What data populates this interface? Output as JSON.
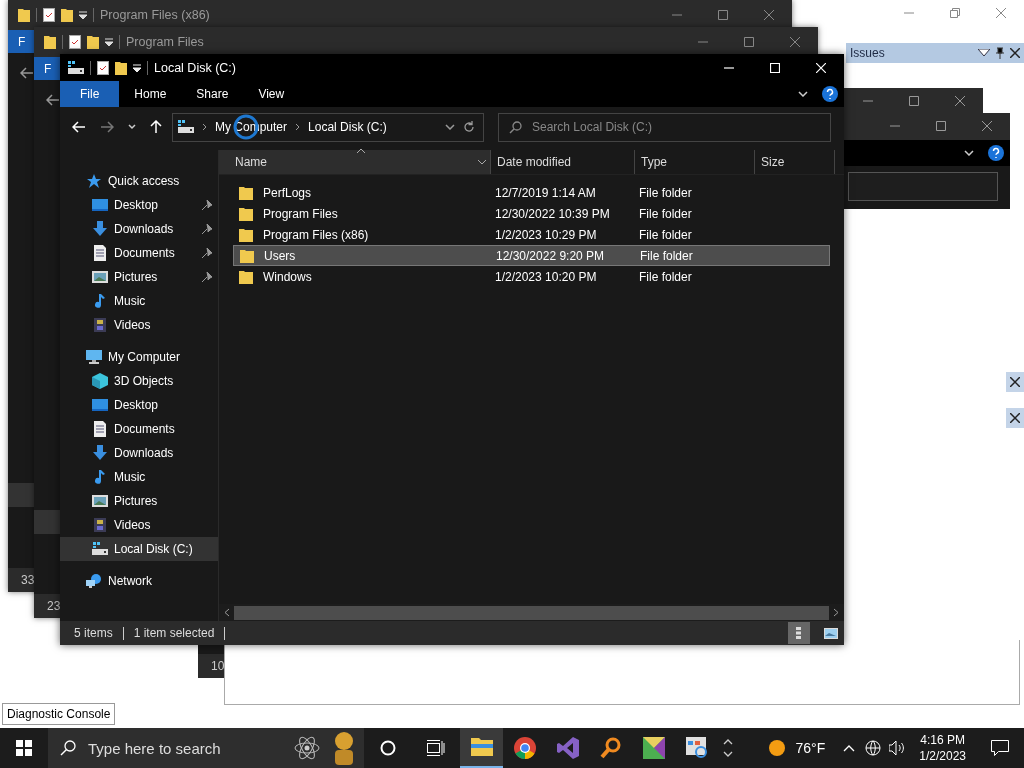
{
  "background_app": {
    "panel_title": "Issues",
    "bottom_tab": "Diagnostic Console"
  },
  "back_windows": [
    {
      "title": "Program Files (x86)",
      "file_tab": "F",
      "status": "33"
    },
    {
      "title": "Program Files",
      "file_tab": "F",
      "status": "23"
    }
  ],
  "fragment_window": {
    "status": "10"
  },
  "explorer": {
    "title": "Local Disk (C:)",
    "ribbon_tabs": [
      {
        "label": "File",
        "selected": true
      },
      {
        "label": "Home",
        "selected": false
      },
      {
        "label": "Share",
        "selected": false
      },
      {
        "label": "View",
        "selected": false
      }
    ],
    "breadcrumb": [
      "My Computer",
      "Local Disk (C:)"
    ],
    "search": {
      "placeholder": "Search Local Disk (C:)"
    },
    "sidebar": [
      {
        "label": "Quick access",
        "kind": "star",
        "selected": false,
        "children": [
          {
            "label": "Desktop",
            "kind": "desktop",
            "pinned": true,
            "selected": false
          },
          {
            "label": "Downloads",
            "kind": "download",
            "pinned": true,
            "selected": false
          },
          {
            "label": "Documents",
            "kind": "document",
            "pinned": true,
            "selected": false
          },
          {
            "label": "Pictures",
            "kind": "picture",
            "pinned": true,
            "selected": false
          },
          {
            "label": "Music",
            "kind": "music",
            "pinned": false,
            "selected": false
          },
          {
            "label": "Videos",
            "kind": "video",
            "pinned": false,
            "selected": false
          }
        ]
      },
      {
        "label": "My Computer",
        "kind": "computer",
        "selected": false,
        "children": [
          {
            "label": "3D Objects",
            "kind": "cube",
            "pinned": false,
            "selected": false
          },
          {
            "label": "Desktop",
            "kind": "desktop",
            "pinned": false,
            "selected": false
          },
          {
            "label": "Documents",
            "kind": "document",
            "pinned": false,
            "selected": false
          },
          {
            "label": "Downloads",
            "kind": "download",
            "pinned": false,
            "selected": false
          },
          {
            "label": "Music",
            "kind": "music",
            "pinned": false,
            "selected": false
          },
          {
            "label": "Pictures",
            "kind": "picture",
            "pinned": false,
            "selected": false
          },
          {
            "label": "Videos",
            "kind": "video",
            "pinned": false,
            "selected": false
          },
          {
            "label": "Local Disk (C:)",
            "kind": "drive",
            "pinned": false,
            "selected": true
          }
        ]
      },
      {
        "label": "Network",
        "kind": "network",
        "selected": false
      }
    ],
    "columns": [
      {
        "label": "Name",
        "sorted": true
      },
      {
        "label": "Date modified",
        "sorted": false
      },
      {
        "label": "Type",
        "sorted": false
      },
      {
        "label": "Size",
        "sorted": false
      }
    ],
    "rows": [
      {
        "name": "PerfLogs",
        "date": "12/7/2019 1:14 AM",
        "type": "File folder",
        "selected": false
      },
      {
        "name": "Program Files",
        "date": "12/30/2022 10:39 PM",
        "type": "File folder",
        "selected": false
      },
      {
        "name": "Program Files (x86)",
        "date": "1/2/2023 10:29 PM",
        "type": "File folder",
        "selected": false
      },
      {
        "name": "Users",
        "date": "12/30/2022 9:20 PM",
        "type": "File folder",
        "selected": true
      },
      {
        "name": "Windows",
        "date": "1/2/2023 10:20 PM",
        "type": "File folder",
        "selected": false
      }
    ],
    "status_bar": {
      "count": "5 items",
      "selection": "1 item selected"
    }
  },
  "taskbar": {
    "search_placeholder": "Type here to search",
    "apps": [
      {
        "kind": "explorer",
        "active": true
      },
      {
        "kind": "chrome",
        "active": false
      },
      {
        "kind": "studio",
        "active": false
      },
      {
        "kind": "magnifier",
        "active": false
      },
      {
        "kind": "map",
        "active": false
      },
      {
        "kind": "chart",
        "active": false
      }
    ],
    "weather": "76°F",
    "time": "4:16 PM",
    "date": "1/2/2023"
  }
}
